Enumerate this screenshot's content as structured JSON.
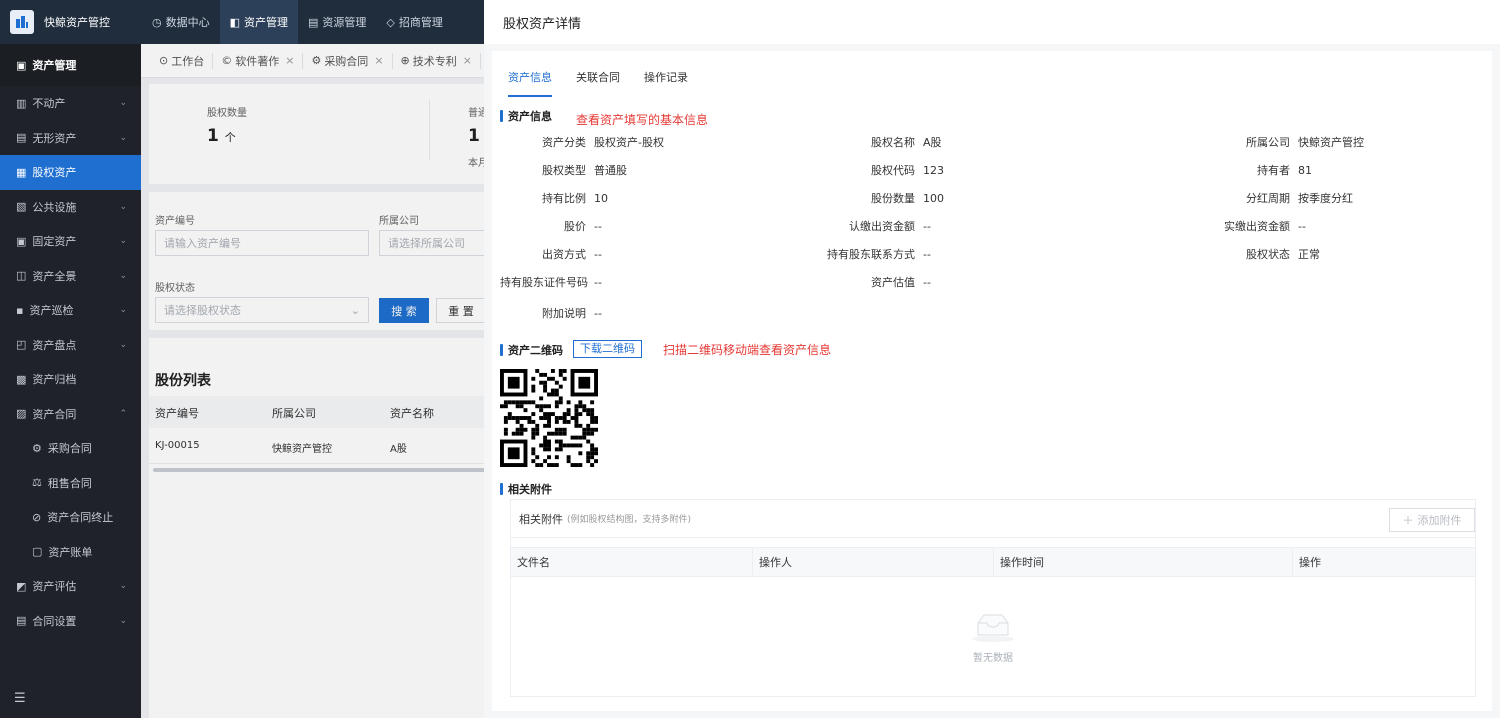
{
  "app": {
    "name": "快鲸资产管控"
  },
  "topnav": [
    {
      "label": "数据中心",
      "icon": "clock-icon",
      "active": false
    },
    {
      "label": "资产管理",
      "icon": "cube-icon",
      "active": true
    },
    {
      "label": "资源管理",
      "icon": "doc-icon",
      "active": false
    },
    {
      "label": "招商管理",
      "icon": "tag-icon",
      "active": false
    }
  ],
  "sidebar": {
    "header": "资产管理",
    "items": [
      {
        "label": "不动产",
        "expand": true
      },
      {
        "label": "无形资产",
        "expand": true
      },
      {
        "label": "股权资产",
        "expand": false,
        "active": true
      },
      {
        "label": "公共设施",
        "expand": true
      },
      {
        "label": "固定资产",
        "expand": true
      },
      {
        "label": "资产全景",
        "expand": true
      },
      {
        "label": "资产巡检",
        "expand": true
      },
      {
        "label": "资产盘点",
        "expand": true
      },
      {
        "label": "资产归档",
        "expand": false
      },
      {
        "label": "资产合同",
        "expand": true,
        "open": true
      }
    ],
    "subitems": [
      "采购合同",
      "租售合同",
      "资产合同终止",
      "资产账单"
    ],
    "items2": [
      {
        "label": "资产评估"
      },
      {
        "label": "合同设置"
      }
    ]
  },
  "tabs": [
    "工作台",
    "软件著作",
    "采购合同",
    "技术专利"
  ],
  "stats": {
    "label1": "股权数量",
    "value1": "1",
    "unit1": "个",
    "label2": "普通",
    "value2": "1",
    "sub2": "本月"
  },
  "filters": {
    "code_label": "资产编号",
    "code_placeholder": "请输入资产编号",
    "company_label": "所属公司",
    "company_placeholder": "请选择所属公司",
    "status_label": "股权状态",
    "status_placeholder": "请选择股权状态",
    "search_btn": "搜 索",
    "reset_btn": "重 置"
  },
  "list": {
    "title": "股份列表",
    "columns": [
      "资产编号",
      "所属公司",
      "资产名称"
    ],
    "rows": [
      [
        "KJ-00015",
        "快鲸资产管控",
        "A股"
      ]
    ]
  },
  "drawer": {
    "title": "股权资产详情",
    "tabs": [
      "资产信息",
      "关联合同",
      "操作记录"
    ],
    "info_title": "资产信息",
    "info_note": "查看资产填写的基本信息",
    "fields": [
      {
        "k": "资产分类",
        "v": "股权资产-股权"
      },
      {
        "k": "股权名称",
        "v": "A股"
      },
      {
        "k": "所属公司",
        "v": "快鲸资产管控"
      },
      {
        "k": "股权类型",
        "v": "普通股"
      },
      {
        "k": "股权代码",
        "v": "123"
      },
      {
        "k": "持有者",
        "v": "81"
      },
      {
        "k": "持有比例",
        "v": "10"
      },
      {
        "k": "股份数量",
        "v": "100"
      },
      {
        "k": "分红周期",
        "v": "按季度分红"
      },
      {
        "k": "股价",
        "v": "--"
      },
      {
        "k": "认缴出资金额",
        "v": "--"
      },
      {
        "k": "实缴出资金额",
        "v": "--"
      },
      {
        "k": "出资方式",
        "v": "--"
      },
      {
        "k": "持有股东联系方式",
        "v": "--"
      },
      {
        "k": "股权状态",
        "v": "正常"
      },
      {
        "k": "持有股东证件号码",
        "v": "--"
      },
      {
        "k": "资产估值",
        "v": "--"
      },
      {
        "k": "附加说明",
        "v": "--"
      }
    ],
    "qr_title": "资产二维码",
    "qr_download": "下载二维码",
    "qr_note": "扫描二维码移动端查看资产信息",
    "attach_title": "相关附件",
    "attach_label": "相关附件",
    "attach_hint": "(例如股权结构图，支持多附件)",
    "attach_add": "添加附件",
    "attach_columns": [
      "文件名",
      "操作人",
      "操作时间",
      "操作"
    ],
    "attach_empty": "暂无数据"
  },
  "colors": {
    "primary": "#1f6fd1",
    "sidebar": "#1f2329",
    "note": "#e53935"
  }
}
